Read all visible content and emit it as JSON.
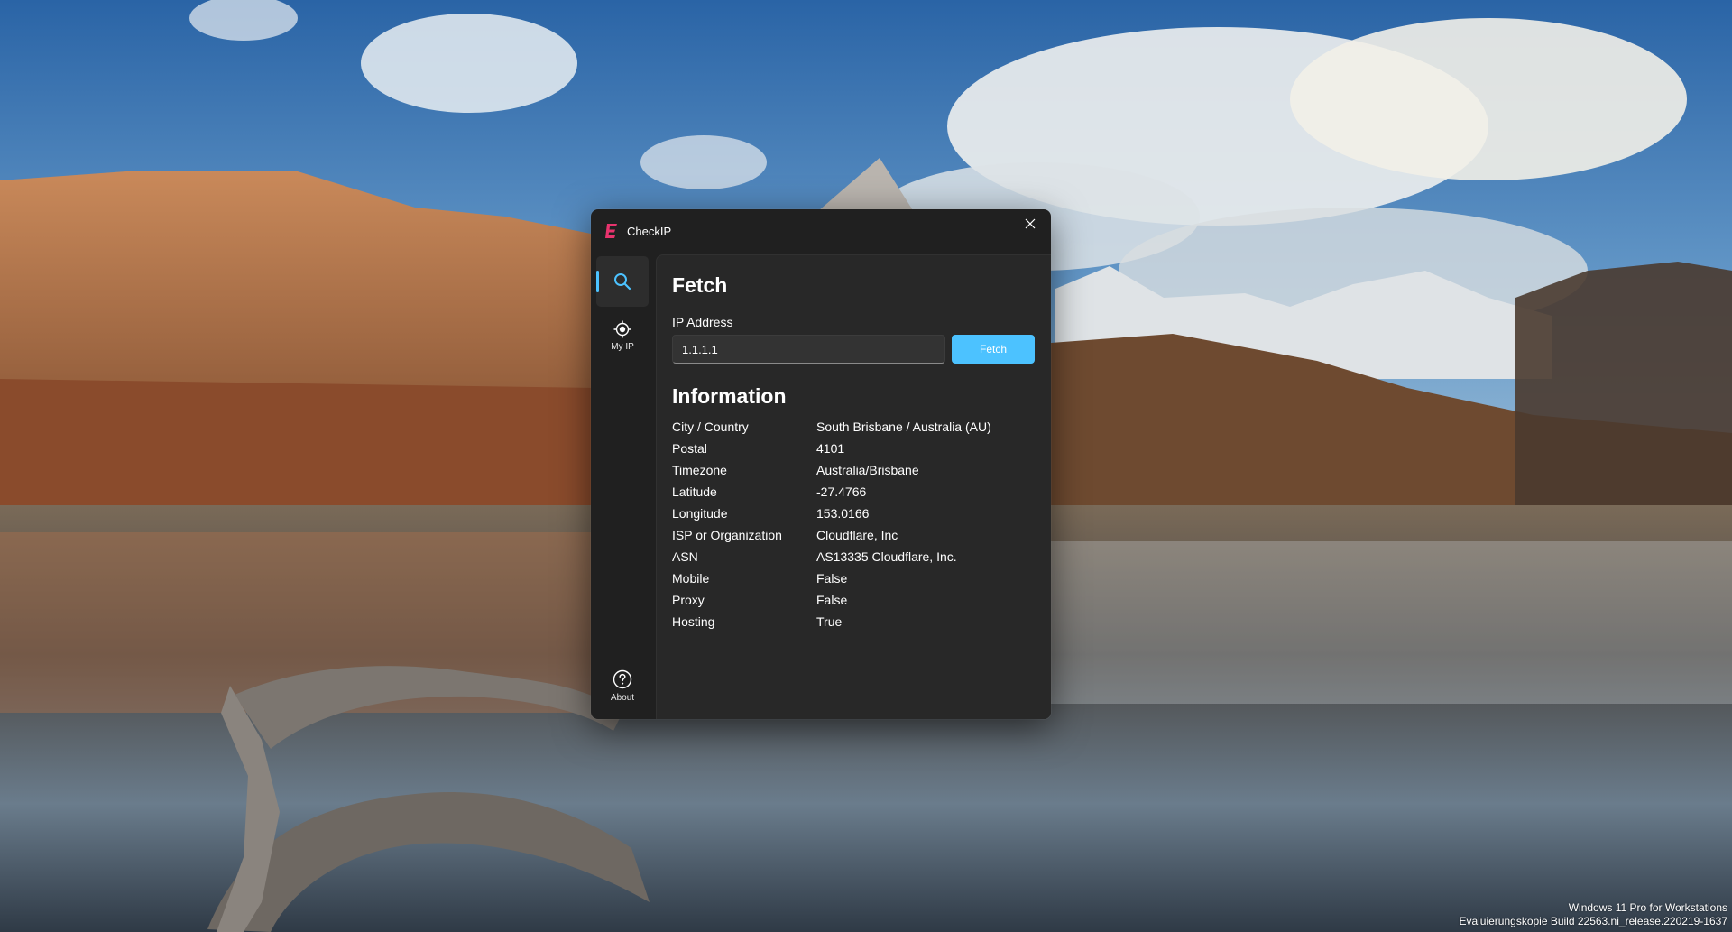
{
  "window": {
    "title": "CheckIP",
    "close_label": "Close"
  },
  "nav": {
    "items": [
      {
        "id": "search",
        "label": "",
        "icon": "search-icon",
        "selected": true
      },
      {
        "id": "myip",
        "label": "My IP",
        "icon": "target-icon",
        "selected": false
      }
    ],
    "footer": {
      "label": "About",
      "icon": "question-circle-icon"
    }
  },
  "fetch": {
    "heading": "Fetch",
    "ip_label": "IP Address",
    "ip_value": "1.1.1.1",
    "button_label": "Fetch"
  },
  "information": {
    "heading": "Information",
    "rows": [
      {
        "key": "City / Country",
        "value": "South Brisbane / Australia (AU)"
      },
      {
        "key": "Postal",
        "value": "4101"
      },
      {
        "key": "Timezone",
        "value": "Australia/Brisbane"
      },
      {
        "key": "Latitude",
        "value": "-27.4766"
      },
      {
        "key": "Longitude",
        "value": "153.0166"
      },
      {
        "key": "ISP or Organization",
        "value": "Cloudflare, Inc"
      },
      {
        "key": "ASN",
        "value": "AS13335 Cloudflare, Inc."
      },
      {
        "key": "Mobile",
        "value": "False"
      },
      {
        "key": "Proxy",
        "value": "False"
      },
      {
        "key": "Hosting",
        "value": "True"
      }
    ]
  },
  "desktop": {
    "watermark_line1": "Windows 11 Pro for Workstations",
    "watermark_line2": "Evaluierungskopie Build 22563.ni_release.220219-1637"
  },
  "colors": {
    "accent": "#4cc2ff",
    "logo": "#e8336d",
    "window_bg": "#202020",
    "panel_bg": "#282828"
  }
}
